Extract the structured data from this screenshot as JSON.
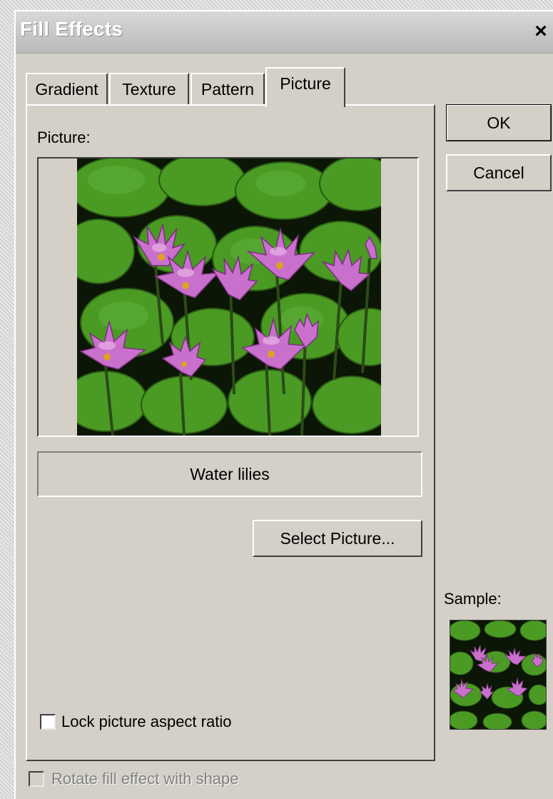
{
  "window": {
    "title": "Fill Effects",
    "close_glyph": "×"
  },
  "tabs": [
    {
      "label": "Gradient",
      "active": false
    },
    {
      "label": "Texture",
      "active": false
    },
    {
      "label": "Pattern",
      "active": false
    },
    {
      "label": "Picture",
      "active": true
    }
  ],
  "picture_tab": {
    "picture_label": "Picture:",
    "picture_name": "Water lilies",
    "select_picture_label": "Select Picture...",
    "lock_aspect_label": "Lock picture aspect ratio",
    "lock_aspect_checked": false
  },
  "buttons": {
    "ok_label": "OK",
    "cancel_label": "Cancel"
  },
  "sample": {
    "label": "Sample:"
  },
  "rotate_fill": {
    "label": "Rotate fill effect with shape",
    "checked": false,
    "enabled": false
  },
  "colors": {
    "dialog_bg": "#d4d0c8",
    "leaf_green": "#3f8a1e",
    "flower_pink": "#c66fc9"
  },
  "icons": {
    "close": "close-icon",
    "checkbox": "checkbox-icon"
  }
}
